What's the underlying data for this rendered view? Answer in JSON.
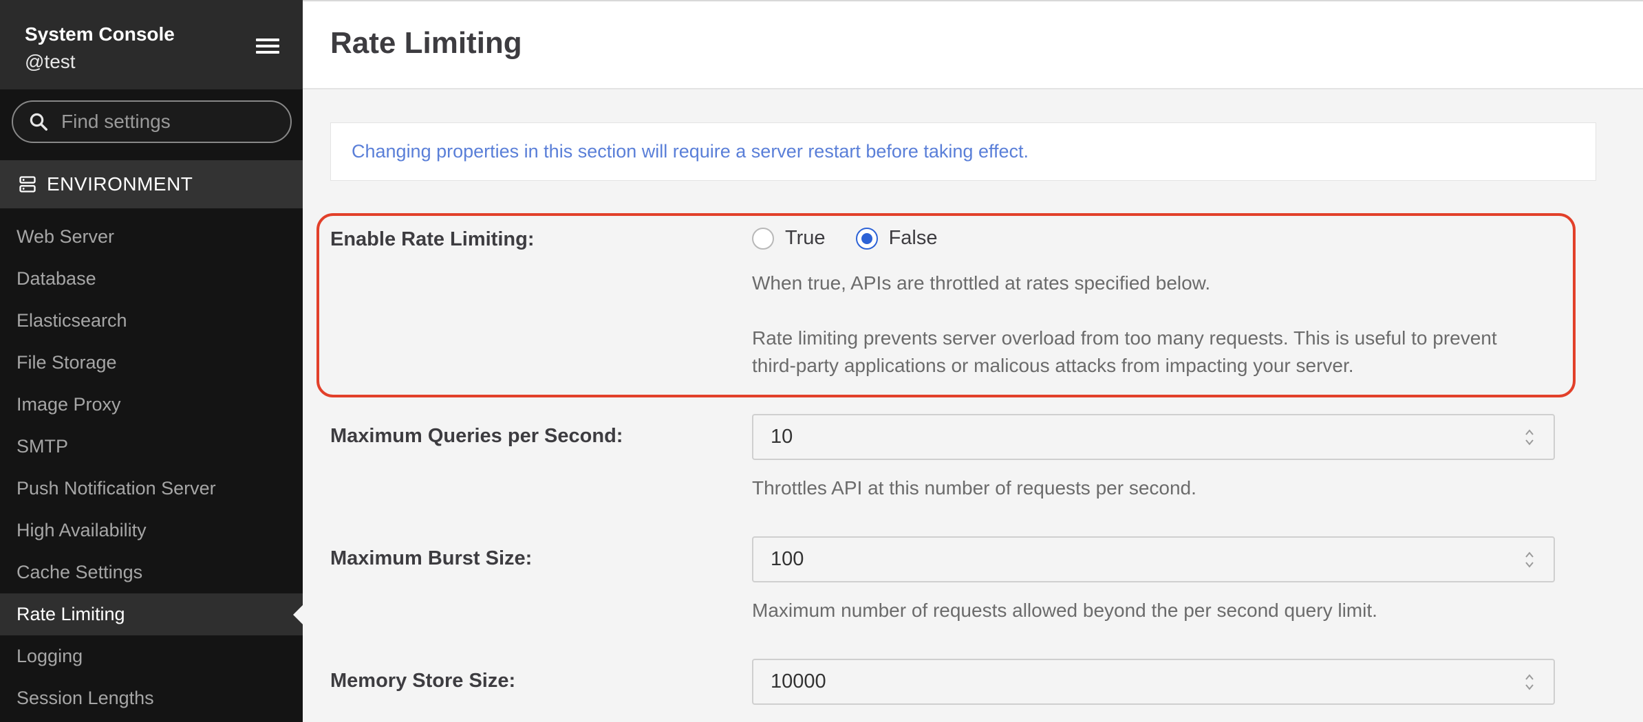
{
  "sidebar": {
    "title": "System Console",
    "user": "@test",
    "search_placeholder": "Find settings",
    "section": "ENVIRONMENT",
    "items": [
      {
        "label": "Web Server"
      },
      {
        "label": "Database"
      },
      {
        "label": "Elasticsearch"
      },
      {
        "label": "File Storage"
      },
      {
        "label": "Image Proxy"
      },
      {
        "label": "SMTP"
      },
      {
        "label": "Push Notification Server"
      },
      {
        "label": "High Availability"
      },
      {
        "label": "Cache Settings"
      },
      {
        "label": "Rate Limiting",
        "active": true
      },
      {
        "label": "Logging"
      },
      {
        "label": "Session Lengths"
      }
    ]
  },
  "main": {
    "title": "Rate Limiting",
    "banner": "Changing properties in this section will require a server restart before taking effect.",
    "enable": {
      "label": "Enable Rate Limiting:",
      "options": [
        "True",
        "False"
      ],
      "selected": "False",
      "help1": "When true, APIs are throttled at rates specified below.",
      "help2_line1": "Rate limiting prevents server overload from too many requests. This is useful to prevent",
      "help2_line2": "third-party applications or malicous attacks from impacting your server."
    },
    "max_qps": {
      "label": "Maximum Queries per Second:",
      "value": "10",
      "help": "Throttles API at this number of requests per second."
    },
    "max_burst": {
      "label": "Maximum Burst Size:",
      "value": "100",
      "help": "Maximum number of requests allowed beyond the per second query limit."
    },
    "memory_store": {
      "label": "Memory Store Size:",
      "value": "10000"
    }
  },
  "colors": {
    "highlight_border": "#e2402a",
    "radio_accent": "#2c62d6",
    "banner_text": "#5a7fd8"
  }
}
